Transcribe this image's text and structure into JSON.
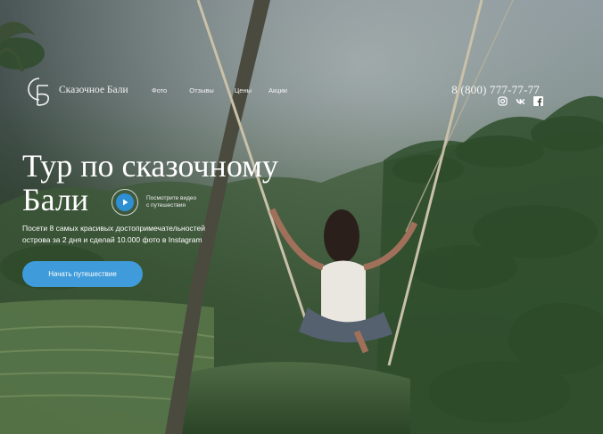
{
  "brand": {
    "logo_text": "Сказочное Бали",
    "logo_icon": "sb-monogram-icon"
  },
  "nav": {
    "items": [
      {
        "label": "Фото"
      },
      {
        "label": "Отзывы"
      },
      {
        "label": "Цены"
      },
      {
        "label": "Акции"
      }
    ]
  },
  "contact": {
    "phone": "8 (800) 777-77-77",
    "socials": [
      "instagram-icon",
      "vk-icon",
      "facebook-icon"
    ]
  },
  "hero": {
    "title_line1": "Тур по сказочному",
    "title_line2": "Бали",
    "video_caption_line1": "Посмотрите видео",
    "video_caption_line2": "с путешествия",
    "subtitle_line1": "Посети 8 самых красивых достопримечательностей",
    "subtitle_line2": "острова за 2 дня и сделай 10.000 фото в Instagram",
    "cta_label": "Начать путешествие"
  },
  "colors": {
    "accent": "#3f9bd9",
    "play": "#2f8fd3",
    "text": "#ffffff"
  }
}
